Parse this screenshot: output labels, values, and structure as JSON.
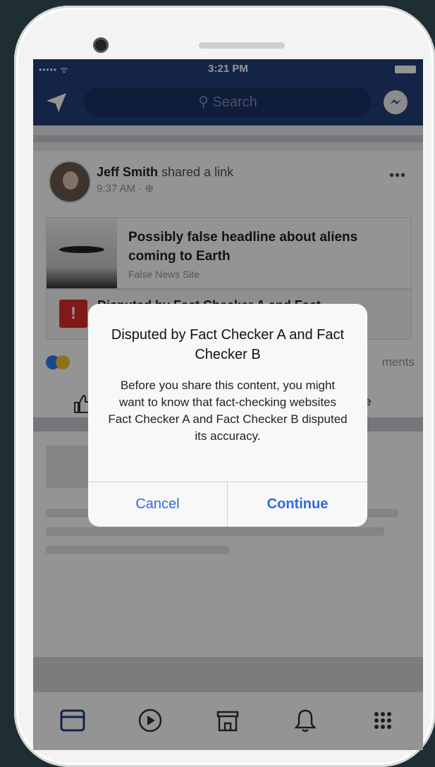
{
  "status_bar": {
    "carrier": "••••• ᯤ",
    "time": "3:21 PM"
  },
  "nav": {
    "search_placeholder": "Search"
  },
  "post": {
    "author": "Jeff Smith",
    "action": "shared a link",
    "time": "9:37 AM · ",
    "globe": "⊕",
    "more": "•••",
    "link_title": "Possibly false headline about aliens coming to Earth",
    "link_site": "False News Site",
    "dispute_label": "Disputed by Fact Checker A and Fact",
    "warning_glyph": "!",
    "comments_text": "ments",
    "share_text": "are"
  },
  "dialog": {
    "title": "Disputed by Fact Checker A and Fact Checker B",
    "message": "Before you share this content, you might want to know that fact-checking websites Fact Checker A and Fact Checker B disputed its accuracy.",
    "cancel_label": "Cancel",
    "continue_label": "Continue"
  },
  "tab_bar": {
    "icons": [
      "news-feed-icon",
      "video-icon",
      "marketplace-icon",
      "notifications-icon",
      "menu-icon"
    ]
  },
  "colors": {
    "fb_blue": "#233f7a",
    "dialog_button": "#2d6cdf",
    "warning_red": "#e02b2b"
  }
}
